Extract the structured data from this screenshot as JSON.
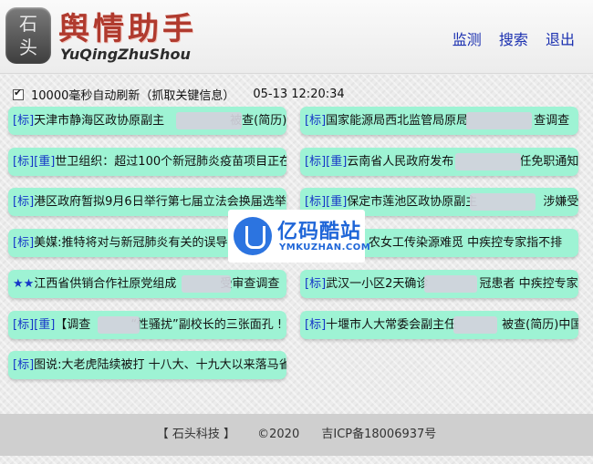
{
  "header": {
    "logo_glyphs": [
      "石",
      "头"
    ],
    "title": "舆情助手",
    "subtitle": "YuQingZhuShou",
    "nav": [
      "监测",
      "搜索",
      "退出"
    ]
  },
  "status": {
    "auto_refresh_checked": true,
    "auto_refresh_label": "10000毫秒自动刷新（抓取关键信息）",
    "timestamp": "05-13 12:20:34"
  },
  "cards": [
    {
      "tags": "[标]",
      "text": "天津市静海区政协原副主",
      "tail": "被查(简历)中国"
    },
    {
      "tags": "[标]",
      "text": "国家能源局西北监管局原局",
      "tail": "查调查"
    },
    {
      "tags": "[标][重]",
      "text": "世卫组织：超过100个新冠肺炎疫苗项目正在",
      "tail": ""
    },
    {
      "tags": "[标][重]",
      "text": "云南省人民政府发布",
      "tail": "任免职通知网"
    },
    {
      "tags": "[标]",
      "text": "港区政府暂拟9月6日举行第七届立法会换届选举",
      "tail": ""
    },
    {
      "tags": "[标][重]",
      "text": "保定市莲池区政协原副主",
      "tail": "涉嫌受贿、"
    },
    {
      "tags": "[标]",
      "text": "美媒:推特将对与新冠肺炎有关的误导",
      "tail": ""
    },
    {
      "tags": "",
      "text": "",
      "tail": "农女工传染源难觅 中疾控专家指不排"
    },
    {
      "tags": "★★",
      "text": "江西省供销合作社原党组成",
      "tail": "受审查调查"
    },
    {
      "tags": "[标]",
      "text": "武汉一小区2天确诊",
      "tail": "冠患者 中疾控专家去而"
    },
    {
      "tags": "[标][重]",
      "text": "【调查",
      "tail": "“性骚扰”副校长的三张面孔 !"
    },
    {
      "tags": "[标]",
      "text": "十堰市人大常委会副主任",
      "tail": "被查(简历)中国经"
    },
    {
      "tags": "[标]",
      "text": "图说:大老虎陆续被打 十八大、十九大以来落马省",
      "tail": ""
    }
  ],
  "watermark": {
    "title": "亿码酷站",
    "subtitle": "YMKUZHAN.COM"
  },
  "footer": {
    "company": "【 石头科技 】",
    "copyright": "©2020",
    "icp": "吉ICP备18006937号"
  }
}
